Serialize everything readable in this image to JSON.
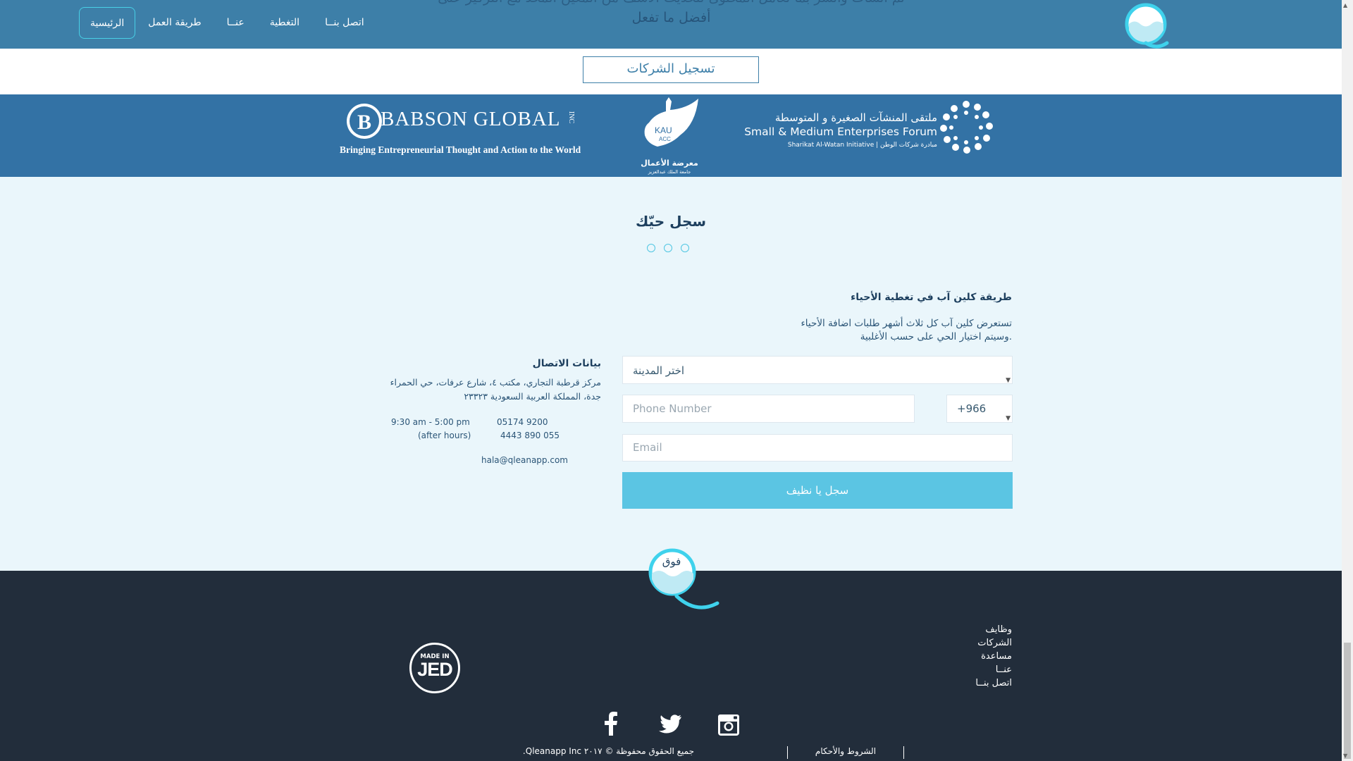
{
  "nav": {
    "items": [
      {
        "label": "الرئيسية",
        "active": true
      },
      {
        "label": "طريقة العمل",
        "active": false
      },
      {
        "label": "عنــا",
        "active": false
      },
      {
        "label": "التغطية",
        "active": false
      },
      {
        "label": "اتصل بنــا",
        "active": false
      }
    ],
    "overlay_line1": "تم انشأت وأنشر بما تعامل المحتوى لتحديث الاسف من المعين المحد مع التركيز على",
    "overlay_line2": "أفضل ما تفعل"
  },
  "companies_button": "تسجيل الشركات",
  "partners": {
    "babson_title": "BABSON GLOBAL",
    "babson_inc": "INC",
    "babson_tagline": "Bringing Entrepreneurial Thought and Action to the World",
    "kau_logo_text": "KAU",
    "kau_logo_sub": "ACC",
    "kau_arabic": "معرضة الأعمال",
    "kau_arabic_sub": "جامعة الملك عبدالعزيز",
    "sme_arabic": "ملتقى المنشآت الصغيرة و المتوسطة",
    "sme_english": "Small & Medium Enterprises Forum",
    "sme_sub": "Sharikat Al-Watan Initiative | مبادرة شركات الوطن"
  },
  "register": {
    "title": "سجل حيّك",
    "coverage_title": "طريقة كلين آب في تغطية الأحياء",
    "coverage_text_1": "تستعرض كلين آب كل ثلاث أشهر طلبات اضافة الأحياء",
    "coverage_text_2": ".وسيتم اختيار الحي على حسب الأغلبية",
    "city_placeholder": "اختر المدينة",
    "phone_placeholder": "Phone Number",
    "country_code": "+966",
    "email_placeholder": "Email",
    "submit_label": "سجل يا نظيف"
  },
  "contact": {
    "title": "بيانات الاتصال",
    "address_1": "مركز قرطبة التجاري، مكتب ٤، شارع عرفات، حي الحمراء",
    "address_2": "جدة، المملكة العربية السعودية ٢٣٣٢٣",
    "phone_1": "05174 9200",
    "hours": "9:30 am - 5:00 pm",
    "phone_2": "4443 890 055",
    "after_hours": "(after hours)",
    "email": "hala@qleanapp.com"
  },
  "footer": {
    "up_label": "فوق",
    "links": [
      "وظايف",
      "الشركات",
      "مساعدة",
      "عنــا",
      "اتصل بنــا"
    ],
    "made_in_small": "MADE IN",
    "made_in_big": "JED",
    "copyright": "جميع الحقوق محفوظة © ٢٠١٧ Qleanapp Inc.",
    "terms": "الشروط والأحكام",
    "social_icons": [
      "facebook-icon",
      "twitter-icon",
      "instagram-icon"
    ]
  },
  "colors": {
    "nav_bg": "#3d7fa8",
    "partners_bg": "#3372a5",
    "page_bg": "#eaf6fb",
    "accent": "#5bc5e3",
    "footer_bg": "#222d3b"
  }
}
